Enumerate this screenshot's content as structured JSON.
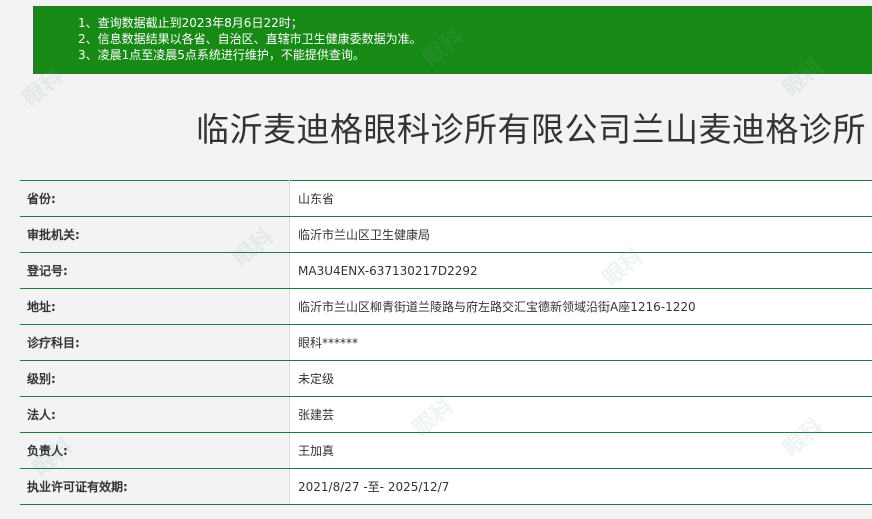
{
  "notice": {
    "lines": [
      "1、查询数据截止到2023年8月6日22时；",
      "2、信息数据结果以各省、自治区、直辖市卫生健康委数据为准。",
      "3、凌晨1点至凌晨5点系统进行维护，不能提供查询。"
    ],
    "background_color": "#178a16"
  },
  "title": "临沂麦迪格眼科诊所有限公司兰山麦迪格诊所",
  "watermark_text": "眼科",
  "info": [
    {
      "label": "省份:",
      "value": "山东省"
    },
    {
      "label": "审批机关:",
      "value": "临沂市兰山区卫生健康局"
    },
    {
      "label": "登记号:",
      "value": "MA3U4ENX-637130217D2292"
    },
    {
      "label": "地址:",
      "value": "临沂市兰山区柳青街道兰陵路与府左路交汇宝德新领域沿街A座1216-1220"
    },
    {
      "label": "诊疗科目:",
      "value": "眼科******"
    },
    {
      "label": "级别:",
      "value": "未定级"
    },
    {
      "label": "法人:",
      "value": "张建芸"
    },
    {
      "label": "负责人:",
      "value": "王加真"
    },
    {
      "label": "执业许可证有效期:",
      "value": "2021/8/27 -至- 2025/12/7"
    }
  ],
  "colors": {
    "row_border": "#1a7a3a",
    "text": "#333333"
  }
}
